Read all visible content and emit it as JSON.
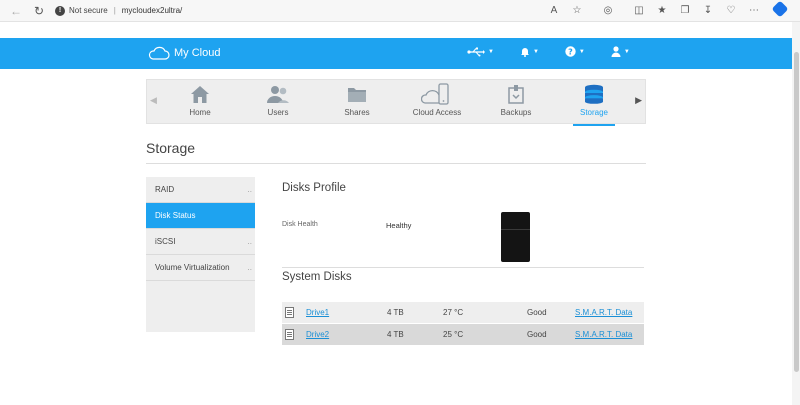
{
  "browser": {
    "security": "Not secure",
    "url": "mycloudex2ultra/"
  },
  "header": {
    "logo_text": "My Cloud",
    "accent_color": "#1ea3f0"
  },
  "nav": {
    "items": [
      {
        "label": "Home",
        "icon": "home-icon"
      },
      {
        "label": "Users",
        "icon": "users-icon"
      },
      {
        "label": "Shares",
        "icon": "folder-icon"
      },
      {
        "label": "Cloud Access",
        "icon": "cloud-devices-icon"
      },
      {
        "label": "Backups",
        "icon": "backup-icon"
      },
      {
        "label": "Storage",
        "icon": "storage-icon",
        "active": true
      }
    ]
  },
  "page": {
    "title": "Storage"
  },
  "sidebar": {
    "items": [
      {
        "label": "RAID"
      },
      {
        "label": "Disk Status",
        "active": true
      },
      {
        "label": "iSCSI"
      },
      {
        "label": "Volume Virtualization"
      }
    ]
  },
  "profile": {
    "title": "Disks Profile",
    "health_label": "Disk Health",
    "health_value": "Healthy"
  },
  "system_disks": {
    "title": "System Disks",
    "rows": [
      {
        "name": "Drive1",
        "size": "4 TB",
        "temp": "27 °C",
        "status": "Good",
        "smart": "S.M.A.R.T. Data"
      },
      {
        "name": "Drive2",
        "size": "4 TB",
        "temp": "25 °C",
        "status": "Good",
        "smart": "S.M.A.R.T. Data"
      }
    ]
  }
}
